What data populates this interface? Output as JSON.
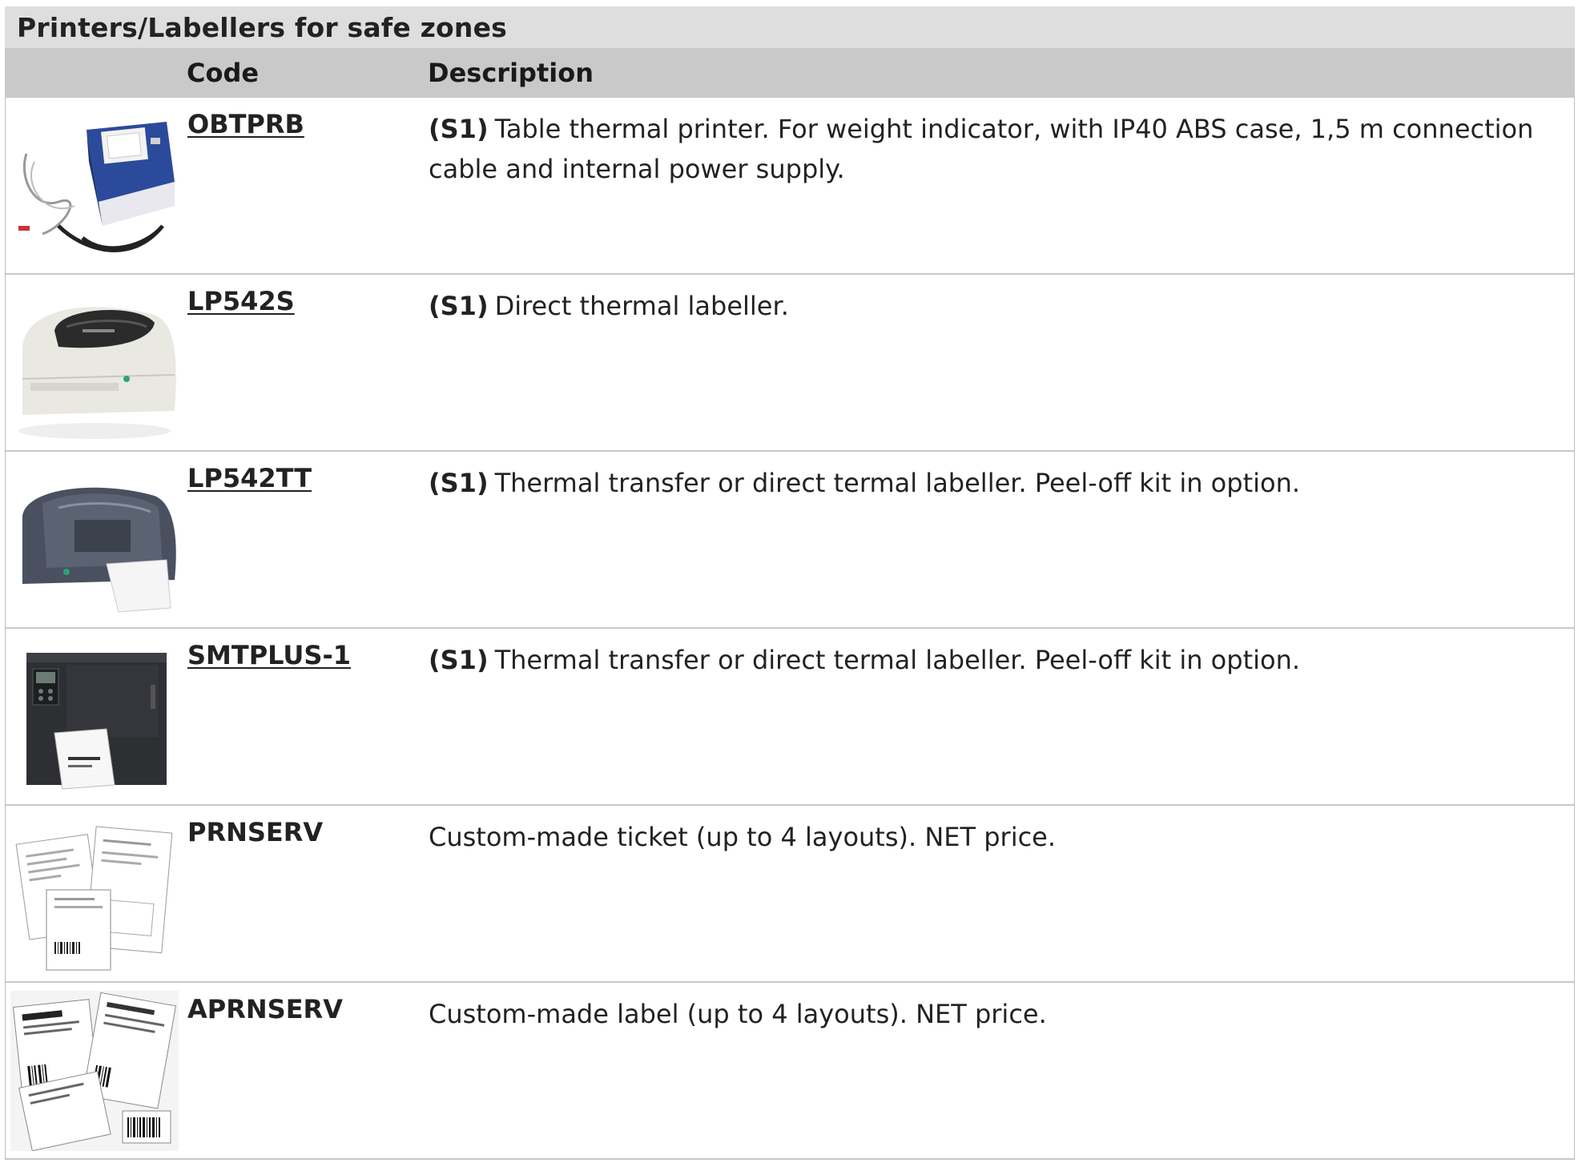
{
  "section": {
    "title": "Printers/Labellers for safe zones"
  },
  "columns": {
    "code": "Code",
    "description": "Description"
  },
  "rows": [
    {
      "code": "OBTPRB",
      "tag": "(S1)",
      "description": "Table thermal printer. For weight indicator, with IP40 ABS case, 1,5 m connection cable and internal power supply.",
      "image": "thermal-printer-with-cable"
    },
    {
      "code": "LP542S",
      "tag": "(S1)",
      "description": "Direct thermal labeller.",
      "image": "white-desktop-labeller"
    },
    {
      "code": "LP542TT",
      "tag": "(S1)",
      "description": "Thermal transfer or direct termal labeller. Peel-off kit in option.",
      "image": "grey-desktop-labeller"
    },
    {
      "code": "SMTPLUS-1",
      "tag": "(S1)",
      "description": "Thermal transfer or direct termal labeller. Peel-off kit in option.",
      "image": "industrial-labeller"
    },
    {
      "code": "PRNSERV",
      "tag": "",
      "description": "Custom-made ticket (up to 4 layouts). NET price.",
      "image": "sample-tickets"
    },
    {
      "code": "APRNSERV",
      "tag": "",
      "description": "Custom-made label (up to 4 layouts). NET price.",
      "image": "sample-labels"
    }
  ]
}
